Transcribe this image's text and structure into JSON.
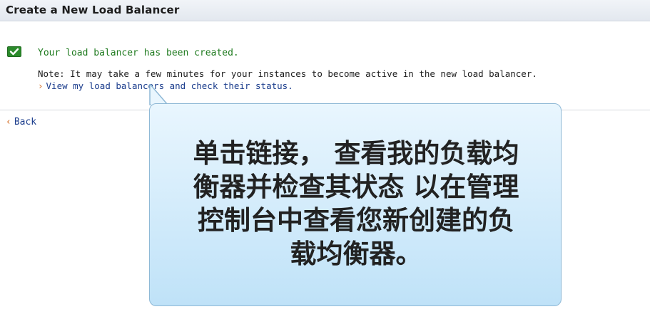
{
  "header": {
    "title": "Create a New Load Balancer"
  },
  "status": {
    "icon": "success-check-icon",
    "message": "Your load balancer has been created.",
    "note": "Note: It may take a few minutes for your instances to become active in the new load balancer.",
    "link_prefix": "›",
    "link_text": "View my load balancers and check their status."
  },
  "nav": {
    "back_prefix": "‹",
    "back_label": "Back"
  },
  "callout": {
    "lines": [
      "单击链接， 查看我的负载均",
      "衡器并检查其状态 以在管理",
      "控制台中查看您新创建的负",
      "载均衡器。"
    ]
  },
  "colors": {
    "success_green": "#1e7a1e",
    "link_blue": "#1a3c8c",
    "chevron_orange": "#d2691e",
    "callout_bg": "#cce9fb",
    "callout_border": "#8fb9d6"
  }
}
